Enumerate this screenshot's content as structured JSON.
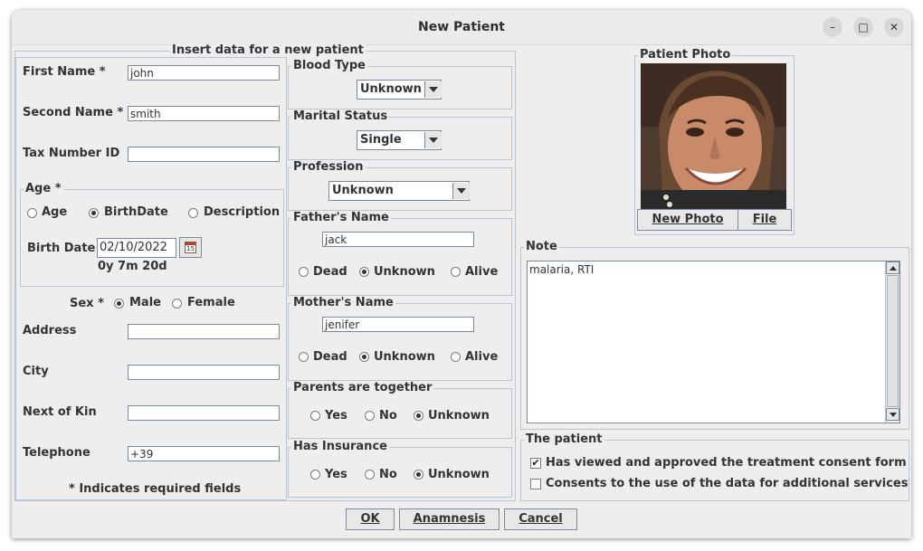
{
  "window": {
    "title": "New Patient",
    "minimize_glyph": "–",
    "maximize_glyph": "□",
    "close_glyph": "✕"
  },
  "insert_group": {
    "legend": "Insert data for a new patient"
  },
  "first_name": {
    "label": "First Name *",
    "value": "john"
  },
  "second_name": {
    "label": "Second Name *",
    "value": "smith"
  },
  "tax_number": {
    "label": "Tax Number ID",
    "value": ""
  },
  "age_group": {
    "legend": "Age *",
    "options": [
      "Age",
      "BirthDate",
      "Description"
    ],
    "selected": "BirthDate",
    "birth_date_label": "Birth Date",
    "birth_date_value": "02/10/2022",
    "calendar_day": "15",
    "age_text": "0y 7m 20d"
  },
  "sex": {
    "label": "Sex *",
    "options": [
      "Male",
      "Female"
    ],
    "selected": "Male"
  },
  "address": {
    "label": "Address",
    "value": ""
  },
  "city": {
    "label": "City",
    "value": ""
  },
  "next_of_kin": {
    "label": "Next of Kin",
    "value": ""
  },
  "telephone": {
    "label": "Telephone",
    "value": "+39"
  },
  "required_note": "* Indicates required fields",
  "blood_type": {
    "legend": "Blood Type",
    "value": "Unknown"
  },
  "marital_status": {
    "legend": "Marital Status",
    "value": "Single"
  },
  "profession": {
    "legend": "Profession",
    "value": "Unknown"
  },
  "father": {
    "legend": "Father's Name",
    "value": "jack",
    "options": [
      "Dead",
      "Unknown",
      "Alive"
    ],
    "selected": "Unknown"
  },
  "mother": {
    "legend": "Mother's Name",
    "value": "jenifer",
    "options": [
      "Dead",
      "Unknown",
      "Alive"
    ],
    "selected": "Unknown"
  },
  "parents_together": {
    "legend": "Parents are together",
    "options": [
      "Yes",
      "No",
      "Unknown"
    ],
    "selected": "Unknown"
  },
  "insurance": {
    "legend": "Has Insurance",
    "options": [
      "Yes",
      "No",
      "Unknown"
    ],
    "selected": "Unknown"
  },
  "photo": {
    "legend": "Patient Photo",
    "new_photo_label": "New Photo",
    "file_label": "File"
  },
  "note": {
    "legend": "Note",
    "value": "malaria, RTI"
  },
  "the_patient": {
    "legend": "The patient",
    "consent_treatment": {
      "label": "Has viewed and approved the treatment consent form",
      "checked": true
    },
    "consent_data": {
      "label": "Consents to the use of the data for additional services",
      "checked": false
    }
  },
  "buttons": {
    "ok": "OK",
    "anamnesis": "Anamnesis",
    "cancel": "Cancel"
  }
}
